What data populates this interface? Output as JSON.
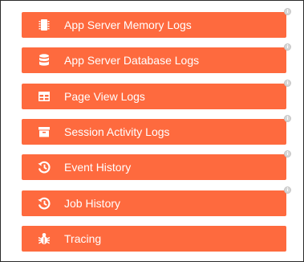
{
  "buttons": [
    {
      "label": "App Server Memory Logs",
      "icon": "memory-chip-icon",
      "has_info": true
    },
    {
      "label": "App Server Database Logs",
      "icon": "database-icon",
      "has_info": true
    },
    {
      "label": "Page View Logs",
      "icon": "table-icon",
      "has_info": true
    },
    {
      "label": "Session Activity Logs",
      "icon": "archive-box-icon",
      "has_info": true
    },
    {
      "label": "Event History",
      "icon": "history-icon",
      "has_info": true
    },
    {
      "label": "Job History",
      "icon": "history-icon",
      "has_info": true
    },
    {
      "label": "Tracing",
      "icon": "bug-icon",
      "has_info": false
    }
  ],
  "colors": {
    "button": "#fe6a3e",
    "text": "#ffffff",
    "info": "#d6d6d6"
  }
}
